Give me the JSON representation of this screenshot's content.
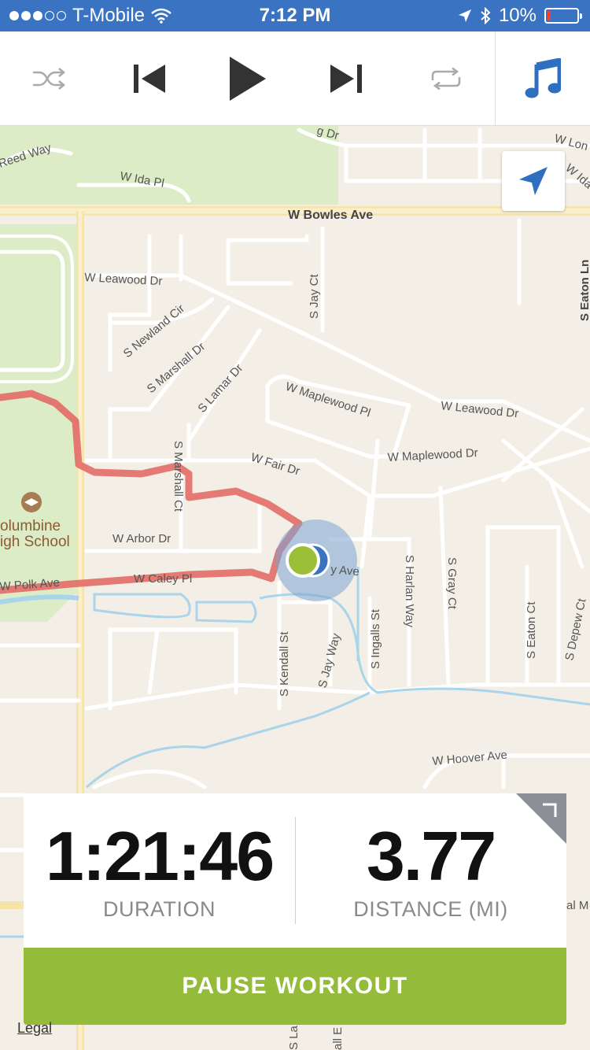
{
  "status_bar": {
    "carrier": "T-Mobile",
    "time": "7:12 PM",
    "battery_percent": "10%",
    "battery_level": 0.1,
    "signal_bars": 3,
    "icons": [
      "signal-dots-icon",
      "wifi-icon",
      "location-arrow-icon",
      "bluetooth-icon",
      "battery-icon"
    ]
  },
  "music_controls": {
    "icons": [
      "shuffle-icon",
      "previous-track-icon",
      "play-icon",
      "next-track-icon",
      "repeat-icon",
      "music-note-icon"
    ],
    "accent_color": "#2f6fbf"
  },
  "map": {
    "street_labels": {
      "reed_way": "Reed Way",
      "ida_pl": "W Ida Pl",
      "bowles": "W Bowles Ave",
      "leawood_top": "W Leawood Dr",
      "jay_ct": "S Jay Ct",
      "newland": "S Newland Cir",
      "marshall_dr": "S Marshall Dr",
      "lamar": "S Lamar Dr",
      "maplewood_pl": "W Maplewood Pl",
      "leawood_right": "W Leawood Dr",
      "maplewood_dr": "W Maplewood Dr",
      "fair": "W Fair Dr",
      "marshall_ct": "S Marshall Ct",
      "arbor": "W Arbor Dr",
      "caley": "W Caley Pl",
      "polk": "W Polk Ave",
      "ave_partial": "y Ave",
      "kendall": "S Kendall St",
      "jay_way": "S Jay Way",
      "ingalls": "S Ingalls St",
      "harlan": "S Harlan Way",
      "gray": "S Gray Ct",
      "eaton_ct": "S Eaton Ct",
      "depew": "S Depew Ct",
      "eaton_ln": "S Eaton Ln",
      "hoover": "W Hoover Ave",
      "top_dr": "g Dr",
      "lon": "W Lon",
      "ida_right": "W Ida",
      "al_m": "al M",
      "la_bottom": "S La",
      "all_bottom": "all E"
    },
    "poi": {
      "name_line1": "olumbine",
      "name_line2": "igh School",
      "icon": "school-icon"
    },
    "route_color": "#e36b66",
    "position_color": "#9bbf36"
  },
  "stats": {
    "duration_value": "1:21:46",
    "duration_label": "DURATION",
    "distance_value": "3.77",
    "distance_label": "DISTANCE (MI)"
  },
  "pause_button": {
    "label": "PAUSE WORKOUT",
    "color": "#95bb3b"
  },
  "legal": "Legal"
}
